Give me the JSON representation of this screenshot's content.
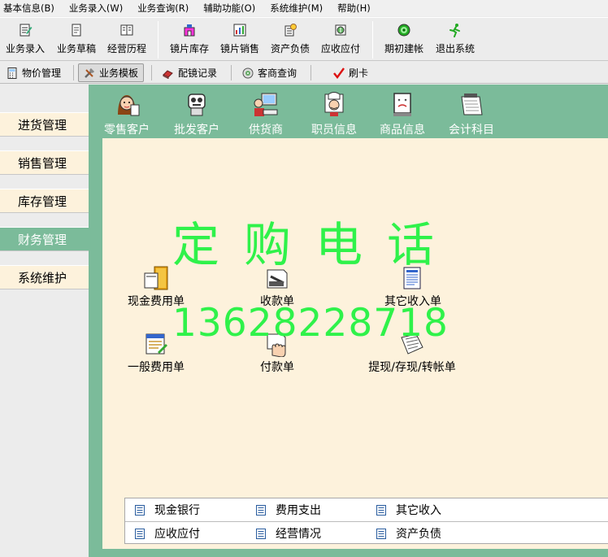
{
  "menu": [
    "基本信息(B)",
    "业务录入(W)",
    "业务查询(R)",
    "辅助功能(O)",
    "系统维护(M)",
    "帮助(H)"
  ],
  "toolbar": {
    "entry": "业务录入",
    "draft": "业务草稿",
    "history": "经营历程",
    "lens_stock": "镜片库存",
    "lens_sales": "镜片销售",
    "assets": "资产负债",
    "receivables": "应收应付",
    "opening": "期初建帐",
    "exit": "退出系统"
  },
  "toolbar2": {
    "price": "物价管理",
    "template": "业务模板",
    "fitting": "配镜记录",
    "customer": "客商查询",
    "card": "刷卡"
  },
  "sidebar": [
    "进货管理",
    "销售管理",
    "库存管理",
    "财务管理",
    "系统维护"
  ],
  "tabs": [
    "零售客户",
    "批发客户",
    "供货商",
    "职员信息",
    "商品信息",
    "会计科目"
  ],
  "docs": {
    "cash_expense": "现金费用单",
    "receipt": "收款单",
    "other_income": "其它收入单",
    "general_expense": "一般费用单",
    "payment": "付款单",
    "transfer": "提现/存现/转帐单"
  },
  "watermark": {
    "line1": "定购电话",
    "line2": "13628228718"
  },
  "links": {
    "row1": [
      "现金银行",
      "费用支出",
      "其它收入"
    ],
    "row2": [
      "应收应付",
      "经营情况",
      "资产负债"
    ]
  },
  "colors": {
    "accent": "#7bbb9a",
    "panel": "#fdf2dc",
    "watermark": "#2ff24a"
  }
}
